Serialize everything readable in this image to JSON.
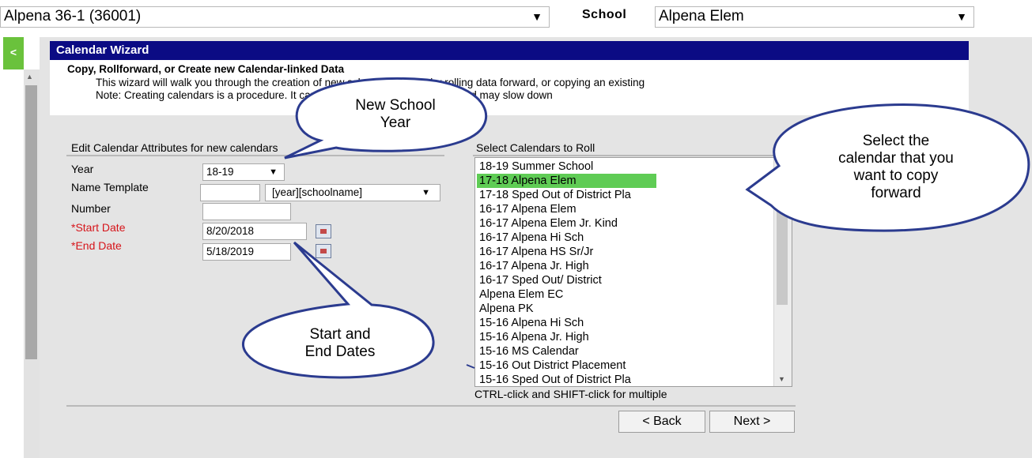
{
  "top": {
    "district_select": "Alpena 36-1 (36001)",
    "school_label": "School",
    "school_select": "Alpena Elem"
  },
  "nav": {
    "collapse_label": "<"
  },
  "wizard": {
    "title": "Calendar Wizard",
    "heading": "Copy, Rollforward, or Create new Calendar-linked Data",
    "line1": "This wizard will walk you through the creation of new school calendars by rolling data forward, or copying an existing",
    "line2": "Note: Creating calendars is a procedure. It can take a long time to complete, and may slow down"
  },
  "attributes": {
    "section_title": "Edit Calendar Attributes for new calendars",
    "year_label": "Year",
    "year_value": "18-19",
    "name_template_label": "Name Template",
    "name_template_value": "",
    "name_template_option": "[year][schoolname]",
    "number_label": "Number",
    "number_value": "",
    "start_date_label": "*Start Date",
    "start_date_value": "8/20/2018",
    "end_date_label": "*End Date",
    "end_date_value": "5/18/2019"
  },
  "roll": {
    "section_title": "Select Calendars to Roll",
    "items": [
      "18-19 Summer School",
      "17-18 Alpena Elem",
      "17-18 Sped Out of District Pla",
      "16-17 Alpena Elem",
      "16-17 Alpena Elem Jr. Kind",
      "16-17 Alpena Hi Sch",
      "16-17 Alpena HS Sr/Jr",
      "16-17 Alpena Jr. High",
      "16-17 Sped Out/ District",
      "Alpena Elem EC",
      "Alpena PK",
      "15-16 Alpena Hi Sch",
      "15-16 Alpena Jr. High",
      "15-16 MS Calendar",
      "15-16 Out District Placement",
      "15-16 Sped Out of District Pla"
    ],
    "selected_index": 1,
    "hint": "CTRL-click and SHIFT-click for multiple"
  },
  "buttons": {
    "back": "< Back",
    "next": "Next >"
  },
  "callouts": {
    "year_l1": "New School",
    "year_l2": "Year",
    "dates_l1": "Start and",
    "dates_l2": "End Dates",
    "select_l1": "Select the",
    "select_l2": "calendar that you",
    "select_l3": "want to copy",
    "select_l4": "forward"
  },
  "colors": {
    "titlebar": "#0b0b84",
    "highlight": "#5fcc55",
    "required": "#d6141a",
    "nav_button": "#6ac23c",
    "callout_stroke": "#2b3b8f"
  }
}
